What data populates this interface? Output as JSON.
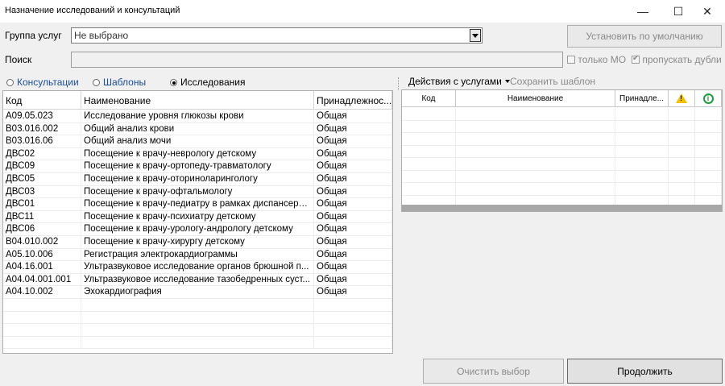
{
  "window": {
    "title": "Назначение исследований и консультаций",
    "minimize": "—",
    "maximize": "☐",
    "close": "✕"
  },
  "form": {
    "group_label": "Группа услуг",
    "group_value": "Не выбрано",
    "default_button": "Установить по умолчанию",
    "search_label": "Поиск",
    "search_value": "",
    "only_mo_label": "только МО",
    "only_mo_checked": false,
    "skip_dupes_label": "пропускать дубли",
    "skip_dupes_checked": true
  },
  "radios": {
    "consult": "Консультации",
    "templates": "Шаблоны",
    "research": "Исследования",
    "selected": "research"
  },
  "left_grid": {
    "headers": [
      "Код",
      "Наименование",
      "Принадлежнос..."
    ],
    "rows": [
      [
        "A09.05.023",
        "Исследование уровня глюкозы крови",
        "Общая"
      ],
      [
        "B03.016.002",
        "Общий анализ крови",
        "Общая"
      ],
      [
        "B03.016.06",
        "Общий анализ мочи",
        "Общая"
      ],
      [
        "ДВС02",
        "Посещение к врачу-неврологу детскому",
        "Общая"
      ],
      [
        "ДВС09",
        "Посещение к врачу-ортопеду-травматологу",
        "Общая"
      ],
      [
        "ДВС05",
        "Посещение к врачу-оториноларингологу",
        "Общая"
      ],
      [
        "ДВС03",
        "Посещение к врачу-офтальмологу",
        "Общая"
      ],
      [
        "ДВС01",
        "Посещение к врачу-педиатру в рамках диспансери...",
        "Общая"
      ],
      [
        "ДВС11",
        "Посещение к врачу-психиатру детскому",
        "Общая"
      ],
      [
        "ДВС06",
        "Посещение к врачу-урологу-андрологу детскому",
        "Общая"
      ],
      [
        "B04.010.002",
        "Посещение к врачу-хирургу детскому",
        "Общая"
      ],
      [
        "A05.10.006",
        "Регистрация электрокардиограммы",
        "Общая"
      ],
      [
        "A04.16.001",
        "Ультразвуковое исследование органов брюшной п...",
        "Общая"
      ],
      [
        "A04.04.001.001",
        "Ультразвуковое исследование тазобедренных суст...",
        "Общая"
      ],
      [
        "A04.10.002",
        "Эхокардиография",
        "Общая"
      ]
    ]
  },
  "right_panel": {
    "actions_menu": "Действия с услугами",
    "save_template": "Сохранить шаблон",
    "headers": [
      "Код",
      "Наименование",
      "Принадле..."
    ]
  },
  "buttons": {
    "clear": "Очистить выбор",
    "continue": "Продолжить"
  }
}
